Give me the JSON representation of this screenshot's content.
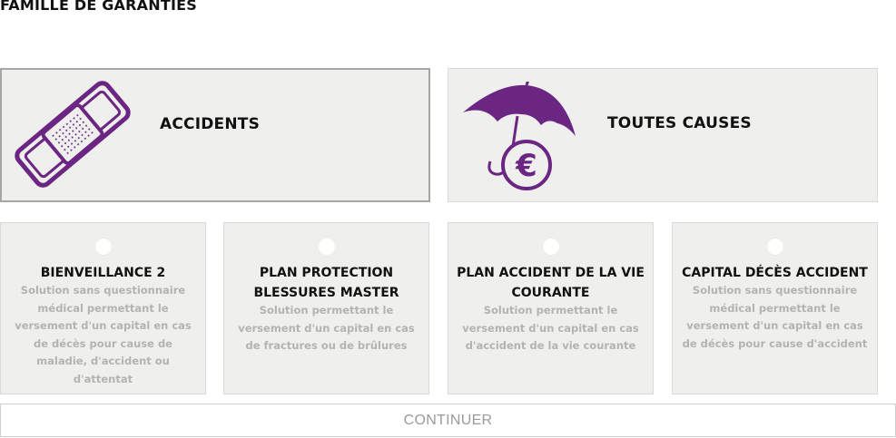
{
  "page": {
    "title": "FAMILLE DE GARANTIES"
  },
  "families": [
    {
      "label": "ACCIDENTS",
      "icon": "bandage-icon",
      "selected": true
    },
    {
      "label": "TOUTES CAUSES",
      "icon": "umbrella-euro-icon",
      "selected": false
    }
  ],
  "products": [
    {
      "title": "BIENVEILLANCE 2",
      "description": "Solution sans questionnaire médical permettant le versement d'un capital en cas de décès pour cause de maladie, d'accident ou d'attentat"
    },
    {
      "title": "PLAN PROTECTION BLESSURES MASTER",
      "description": "Solution permettant le versement d'un capital en cas de fractures ou de brûlures"
    },
    {
      "title": "PLAN ACCIDENT DE LA VIE COURANTE",
      "description": "Solution permettant le versement d'un capital en cas d'accident de la vie courante"
    },
    {
      "title": "CAPITAL DÉCÈS ACCIDENT",
      "description": "Solution sans questionnaire médical permettant le versement d'un capital en cas de décès pour cause d'accident"
    }
  ],
  "actions": {
    "continue_label": "CONTINUER"
  },
  "colors": {
    "accent": "#6b2683",
    "card_bg": "#efefed",
    "muted_text": "#b3b3b1"
  }
}
